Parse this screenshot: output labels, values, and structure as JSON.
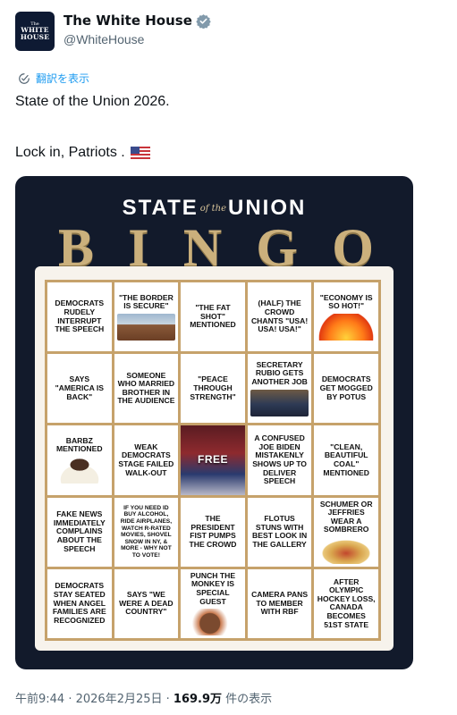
{
  "account": {
    "avatar_top": "The",
    "avatar_line1": "WHITE",
    "avatar_line2": "HOUSE",
    "display_name": "The White House",
    "handle": "@WhiteHouse"
  },
  "translate_label": "翻訳を表示",
  "tweet": {
    "line1": "State of the Union 2026.",
    "line2": "Lock in, Patriots ."
  },
  "image": {
    "title_left": "STATE",
    "title_of": "of the",
    "title_right": "UNION",
    "bingo_letters": [
      "B",
      "I",
      "N",
      "G",
      "O"
    ],
    "cells": [
      "DEMOCRATS RUDELY INTERRUPT THE SPEECH",
      "\"THE BORDER IS SECURE\"",
      "\"THE FAT SHOT\" MENTIONED",
      "(HALF) THE CROWD CHANTS \"USA! USA! USA!\"",
      "\"ECONOMY IS SO HOT!\"",
      "SAYS \"AMERICA IS BACK\"",
      "SOMEONE WHO MARRIED BROTHER IN THE AUDIENCE",
      "\"PEACE THROUGH STRENGTH\"",
      "SECRETARY RUBIO GETS ANOTHER JOB",
      "DEMOCRATS GET MOGGED BY POTUS",
      "BARBZ MENTIONED",
      "WEAK DEMOCRATS STAGE FAILED WALK-OUT",
      "FREE",
      "A CONFUSED JOE BIDEN MISTAKENLY SHOWS UP TO DELIVER SPEECH",
      "\"CLEAN, BEAUTIFUL COAL\" MENTIONED",
      "FAKE NEWS IMMEDIATELY COMPLAINS ABOUT THE SPEECH",
      "IF YOU NEED ID BUY ALCOHOL, RIDE AIRPLANES, WATCH R-RATED MOVIES, SHOVEL SNOW IN NY, & MORE - WHY NOT TO VOTE!",
      "THE PRESIDENT FIST PUMPS THE CROWD",
      "FLOTUS STUNS WITH BEST LOOK IN THE GALLERY",
      "SCHUMER OR JEFFRIES WEAR A SOMBRERO",
      "DEMOCRATS STAY SEATED WHEN ANGEL FAMILIES ARE RECOGNIZED",
      "SAYS \"WE WERE A DEAD COUNTRY\"",
      "PUNCH THE MONKEY IS SPECIAL GUEST",
      "CAMERA PANS TO MEMBER WITH RBF",
      "AFTER OLYMPIC HOCKEY LOSS, CANADA BECOMES 51ST STATE"
    ]
  },
  "footer": {
    "time": "午前9:44",
    "sep1": " · ",
    "date": "2026年2月25日",
    "sep2": " · ",
    "views": "169.9万",
    "views_suffix": " 件の表示"
  },
  "colors": {
    "link": "#1d9bf0",
    "verified": "#829aab",
    "board_bg": "#121a2b",
    "gold": "#c6a26b"
  }
}
